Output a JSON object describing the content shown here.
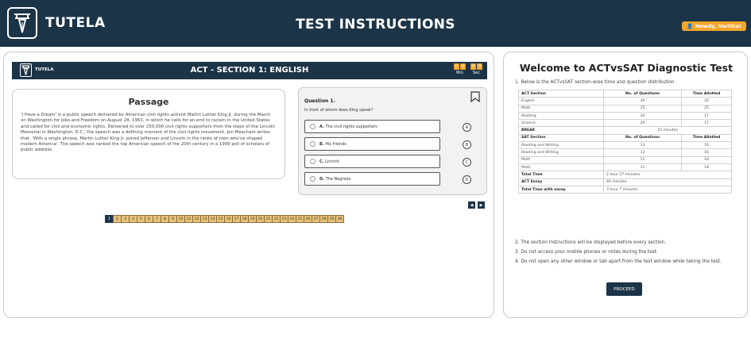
{
  "header": {
    "brand": "TUTELA",
    "title": "TEST INSTRUCTIONS",
    "user_greeting": "Howdy, Vartika!",
    "bg_color": "#1c3447",
    "accent_color": "#f4a62a"
  },
  "test": {
    "mini_brand": "TUTELA",
    "section_title": "ACT - SECTION 1: ENGLISH",
    "timer": {
      "min_digits": [
        "0",
        "0"
      ],
      "sec_digits": [
        "0",
        "0"
      ],
      "min_label": "Min",
      "sec_label": "Sec"
    },
    "passage": {
      "title": "Passage",
      "text": "'I Have a Dream' is a public speech delivered by American civil rights activist Martin Luther King Jr. during the March on Washington for Jobs and Freedom on August 28, 1963, in which he calls for an end to racism in the United States and called for civil and economic rights. Delivered to over 250,000 civil rights supporters from the steps of the Lincoln Memorial in Washington, D.C., the speech was a defining moment of the civil rights movement. Jon Meacham writes that, 'With a single phrase, Martin Luther King Jr. joined Jefferson and Lincoln in the ranks of men who've shaped modern America'. The speech was ranked the top American speech of the 20th century in a 1999 poll of scholars of public address."
    },
    "question": {
      "title": "Question 1.",
      "text": "In front of whom does King speak?",
      "options": [
        {
          "key": "A.",
          "text": "The civil rights supporters",
          "letter": "A"
        },
        {
          "key": "B.",
          "text": "His friends",
          "letter": "B"
        },
        {
          "key": "C.",
          "text": "Lincoln",
          "letter": "C"
        },
        {
          "key": "D.",
          "text": "The Negroes",
          "letter": "D"
        }
      ]
    },
    "nav": {
      "prev": "◀",
      "next": "▶"
    },
    "question_numbers": [
      "1",
      "2",
      "3",
      "4",
      "5",
      "6",
      "7",
      "8",
      "9",
      "10",
      "11",
      "12",
      "13",
      "14",
      "15",
      "16",
      "17",
      "18",
      "19",
      "20",
      "21",
      "22",
      "23",
      "24",
      "25",
      "26",
      "27",
      "28",
      "29",
      "30"
    ],
    "active_question": "1"
  },
  "instructions": {
    "welcome": "Welcome to ACTvsSAT Diagnostic Test",
    "intro": "1. Below is the ACTvsSAT section-wise time and question distribution",
    "table": {
      "act_header": [
        "ACT Section",
        "No. of Questions",
        "Time Allotted"
      ],
      "act_rows": [
        [
          "English",
          "30",
          "20"
        ],
        [
          "Math",
          "25",
          "25"
        ],
        [
          "Reading",
          "20",
          "17"
        ],
        [
          "Science",
          "20",
          "17"
        ]
      ],
      "break_label": "BREAK",
      "break_value": "10 minutes",
      "sat_header": [
        "SAT Section",
        "No. of Questions",
        "Time Allotted"
      ],
      "sat_rows": [
        [
          "Reading and Writing",
          "13",
          "16"
        ],
        [
          "Reading and Writing",
          "13",
          "16"
        ],
        [
          "Math",
          "11",
          "18"
        ],
        [
          "Math",
          "11",
          "18"
        ]
      ],
      "totals": [
        [
          "Total Time",
          "2 hour 27 minutes"
        ],
        [
          "ACT Essay",
          "40 minutes"
        ],
        [
          "Total Time with essay",
          "3 hour 7 minutes"
        ]
      ]
    },
    "notes": [
      "2. The section instructions will be displayed before every section.",
      "3. Do not access your mobile phones or notes during the test.",
      "4. Do not open any other window or tab apart from the test window while taking the test."
    ],
    "proceed_label": "PROCEED"
  }
}
